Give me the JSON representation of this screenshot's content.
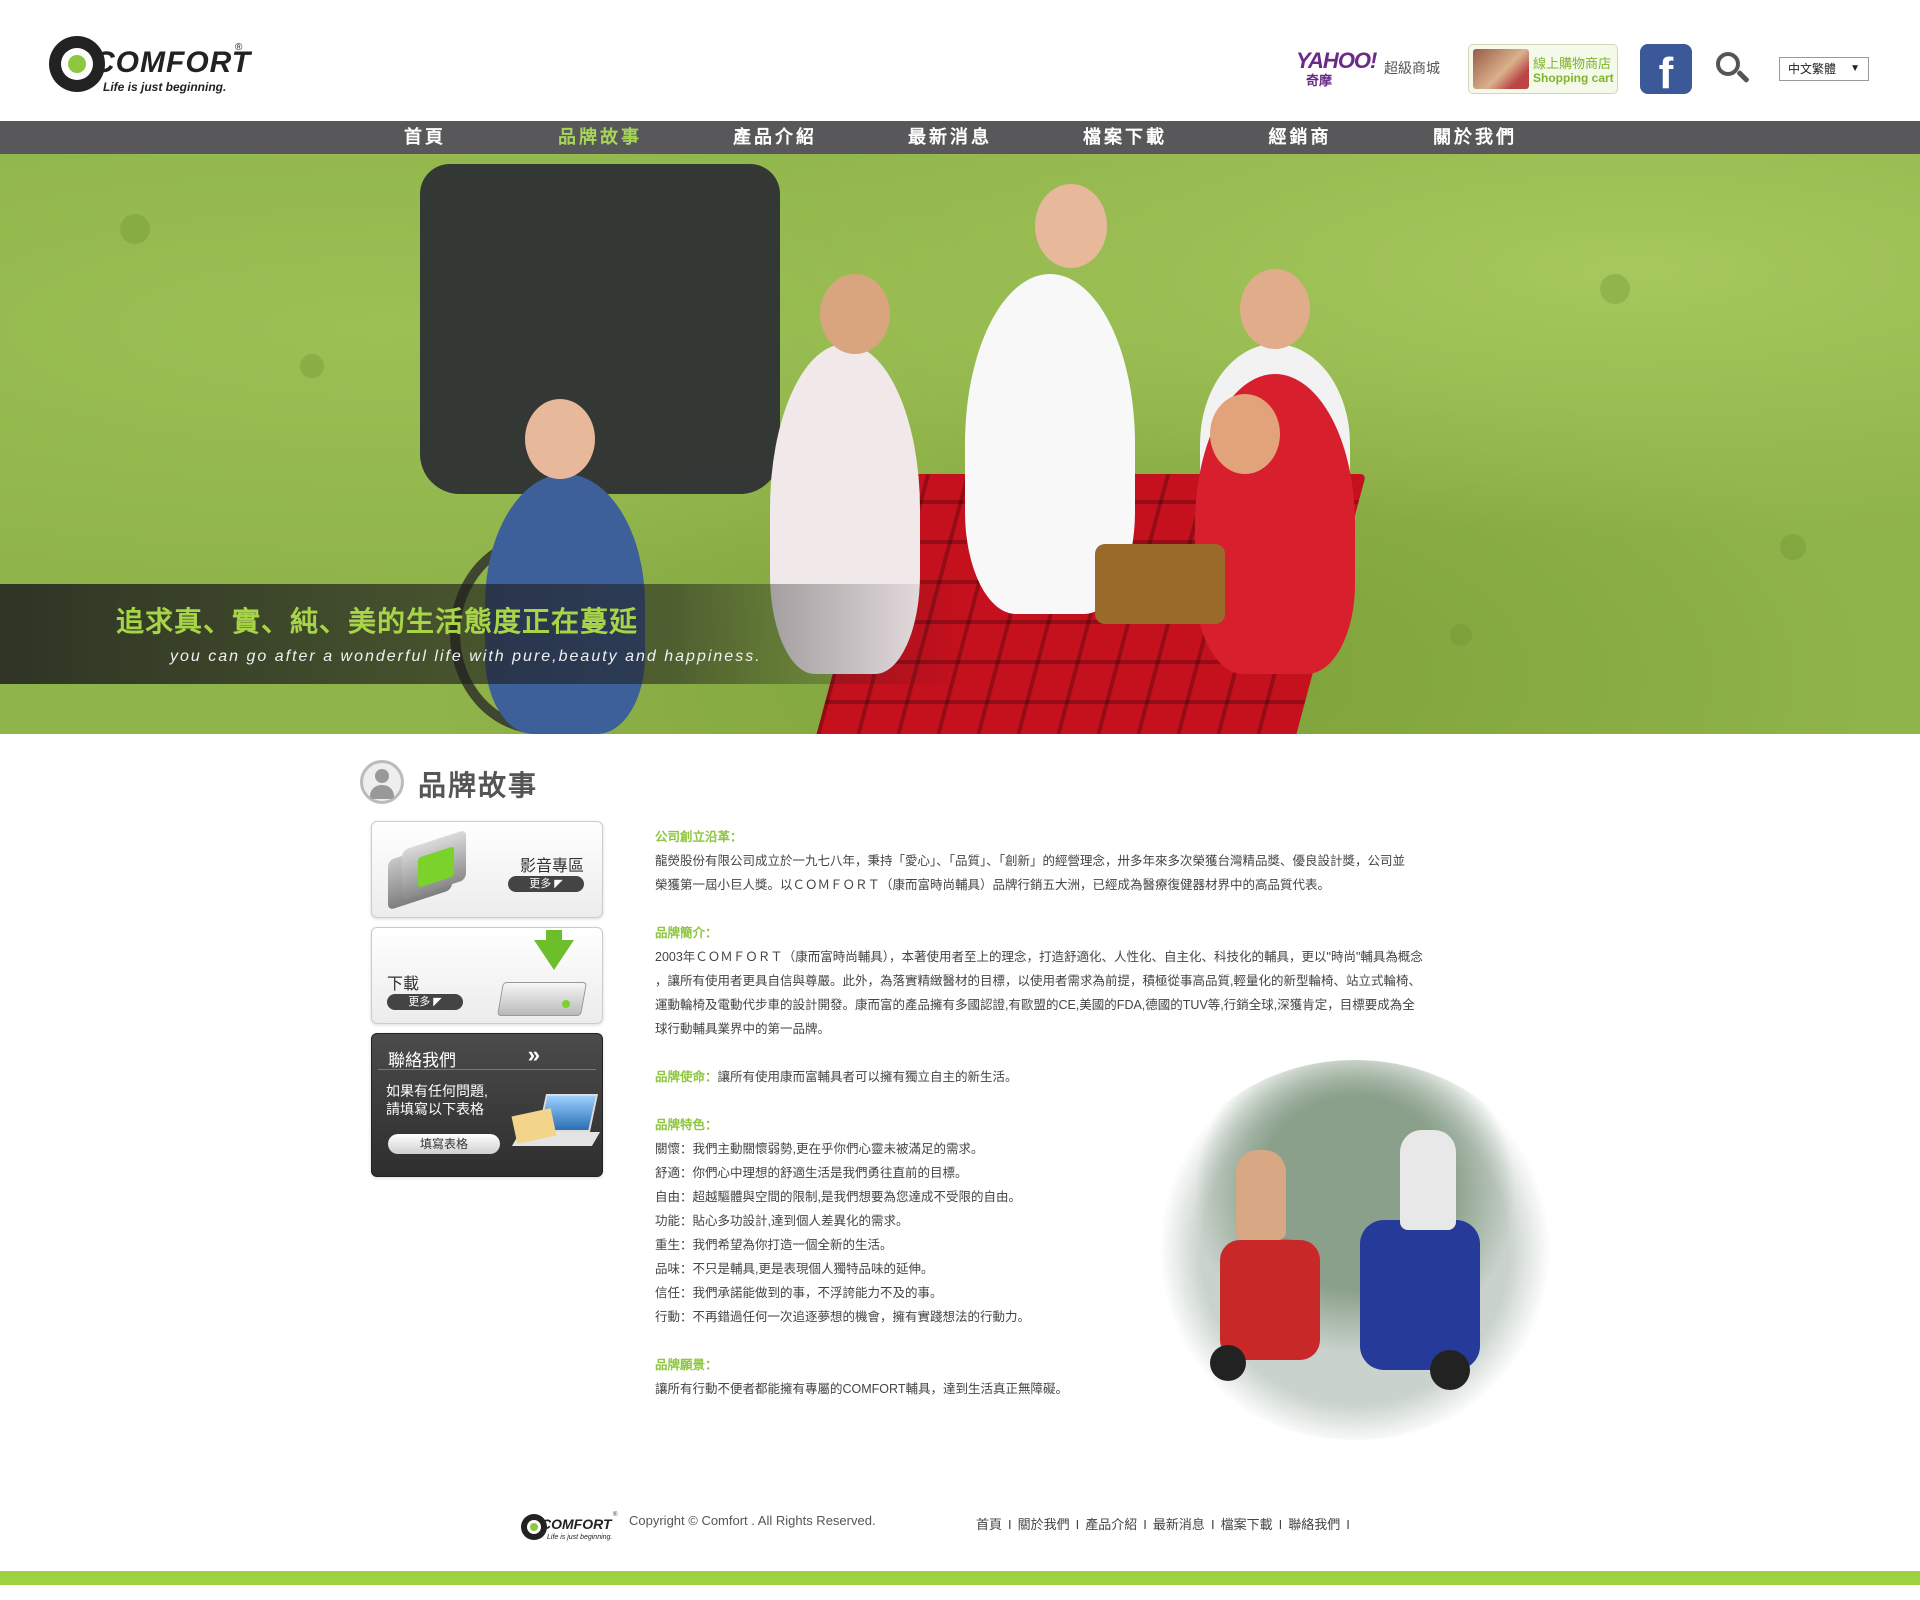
{
  "header": {
    "logo": {
      "wordmark": "COMFORT",
      "registered": "®",
      "tagline": "Life is just beginning."
    },
    "yahoo": {
      "brand": "YAHOO!",
      "sub": "奇摩",
      "mall": "超級商城"
    },
    "shop": {
      "line1": "線上購物商店",
      "line2": "Shopping cart"
    },
    "facebook_glyph": "f",
    "language": {
      "selected": "中文繁體",
      "arrow": "▼"
    }
  },
  "nav": {
    "items": [
      {
        "label": "首頁"
      },
      {
        "label": "品牌故事"
      },
      {
        "label": "產品介紹"
      },
      {
        "label": "最新消息"
      },
      {
        "label": "檔案下載"
      },
      {
        "label": "經銷商"
      },
      {
        "label": "關於我們"
      }
    ],
    "active_index": 1,
    "active_color": "#a6d55a"
  },
  "hero": {
    "caption_main": "追求真、實、純、美的生活態度正在蔓延",
    "caption_sub": "you can go after a wonderful life with pure,beauty and happiness."
  },
  "section": {
    "title": "品牌故事"
  },
  "sidebar": {
    "video": {
      "label": "影音專區",
      "more": "更多 ◤"
    },
    "download": {
      "label": "下載",
      "more": "更多 ◤"
    },
    "contact": {
      "title": "聯絡我們",
      "chevron": "»",
      "desc_line1": "如果有任何問題,",
      "desc_line2": "請填寫以下表格",
      "button": "填寫表格"
    }
  },
  "article": {
    "history_heading": "公司創立沿革：",
    "history_lines": [
      "龍熒股份有限公司成立於一九七八年，秉持「愛心」、「品質」、「創新」的經營理念，卅多年來多次榮獲台灣精品獎、優良設計獎，公司並",
      "榮獲第一屆小巨人獎。以ＣＯＭＦＯＲＴ（康而富時尚輔具）品牌行銷五大洲，已經成為醫療復健器材界中的高品質代表。"
    ],
    "intro_heading": "品牌簡介：",
    "intro_lines": [
      "2003年ＣＯＭＦＯＲＴ（康而富時尚輔具），本著使用者至上的理念，打造舒適化、人性化、自主化、科技化的輔具，更以\"時尚\"輔具為概念",
      "，讓所有使用者更具自信與尊嚴。此外，為落實精緻醫材的目標，以使用者需求為前提，積極從事高品質,輕量化的新型輪椅、站立式輪椅、",
      "運動輪椅及電動代步車的設計開發。康而富的產品擁有多國認證,有歐盟的CE,美國的FDA,德國的TUV等,行銷全球,深獲肯定，目標要成為全",
      "球行動輔具業界中的第一品牌。"
    ],
    "mission_heading": "品牌使命：",
    "mission_text": "讓所有使用康而富輔具者可以擁有獨立自主的新生活。",
    "features_heading": "品牌特色：",
    "features": [
      "關懷：我們主動關懷弱勢,更在乎你們心靈未被滿足的需求。",
      "舒適：你們心中理想的舒適生活是我們勇往直前的目標。",
      "自由：超越驅體與空間的限制,是我們想要為您達成不受限的自由。",
      "功能：貼心多功設計,達到個人差異化的需求。",
      "重生：我們希望為你打造一個全新的生活。",
      "品味：不只是輔具,更是表現個人獨特品味的延伸。",
      "信任：我們承諾能做到的事，不浮誇能力不及的事。",
      "行動：不再錯過任何一次追逐夢想的機會，擁有實踐想法的行動力。"
    ],
    "vision_heading": "品牌願景：",
    "vision_text": "讓所有行動不便者都能擁有專屬的COMFORT輔具，達到生活真正無障礙。"
  },
  "footer": {
    "logo": {
      "wordmark": "COMFORT",
      "registered": "®",
      "tagline": "Life is just beginning."
    },
    "copyright": "Copyright © Comfort . All Rights Reserved.",
    "links": [
      {
        "label": "首頁"
      },
      {
        "label": "關於我們"
      },
      {
        "label": "產品介紹"
      },
      {
        "label": "最新消息"
      },
      {
        "label": "檔案下載"
      },
      {
        "label": "聯絡我們"
      }
    ],
    "separator": "I",
    "bar_color": "#9dd13d"
  },
  "icons": {
    "search": "search-icon",
    "facebook": "facebook-icon",
    "person": "person-icon",
    "film": "film-icon",
    "download": "download-icon",
    "laptop_mail": "laptop-mail-icon"
  }
}
